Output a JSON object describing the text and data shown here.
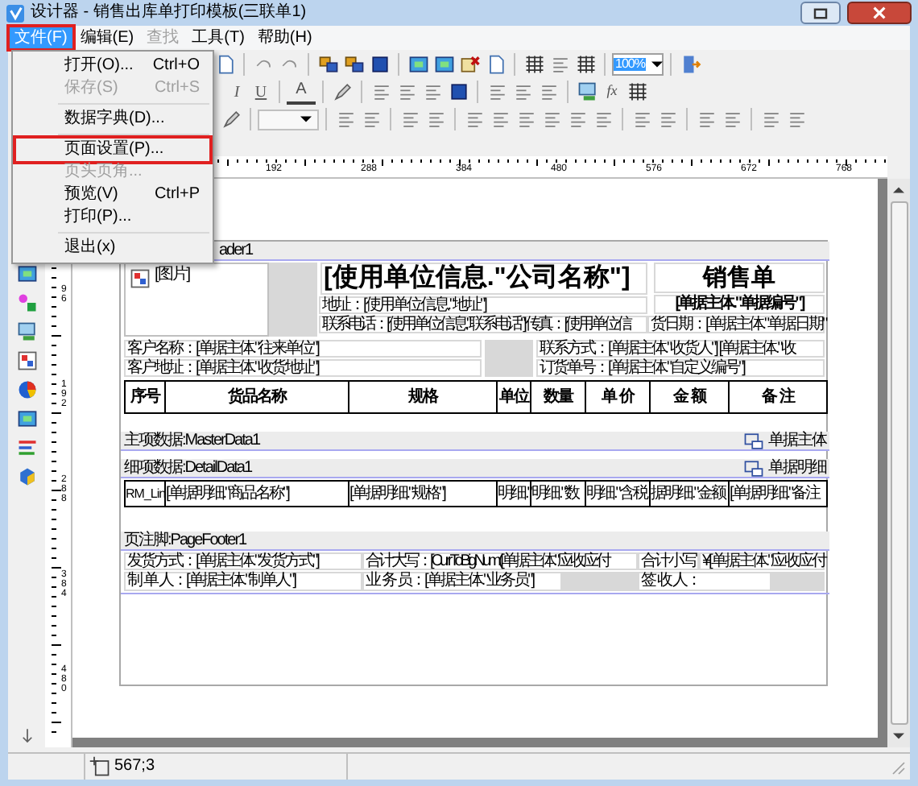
{
  "window": {
    "title": "设计器 - 销售出库单打印模板(三联单1)"
  },
  "menu_bar": [
    {
      "label": "文件(F)",
      "selected": true,
      "disabled": false
    },
    {
      "label": "编辑(E)",
      "selected": false,
      "disabled": false
    },
    {
      "label": "查找",
      "selected": false,
      "disabled": true
    },
    {
      "label": "工具(T)",
      "selected": false,
      "disabled": false
    },
    {
      "label": "帮助(H)",
      "selected": false,
      "disabled": false
    }
  ],
  "file_menu": [
    {
      "kind": "item",
      "label": "打开(O)...",
      "shortcut": "Ctrl+O",
      "disabled": false,
      "highlighted": false
    },
    {
      "kind": "item",
      "label": "保存(S)",
      "shortcut": "Ctrl+S",
      "disabled": true,
      "highlighted": false
    },
    {
      "kind": "separator"
    },
    {
      "kind": "item",
      "label": "数据字典(D)...",
      "disabled": false,
      "highlighted": false
    },
    {
      "kind": "separator"
    },
    {
      "kind": "item",
      "label": "页面设置(P)...",
      "disabled": false,
      "highlighted": true
    },
    {
      "kind": "item",
      "label": "页头页角...",
      "disabled": true,
      "highlighted": false
    },
    {
      "kind": "item",
      "label": "预览(V)",
      "shortcut": "Ctrl+P",
      "disabled": false,
      "highlighted": false
    },
    {
      "kind": "item",
      "label": "打印(P)...",
      "disabled": false,
      "highlighted": false
    },
    {
      "kind": "separator"
    },
    {
      "kind": "item",
      "label": "退出(x)",
      "disabled": false,
      "highlighted": false
    }
  ],
  "toolbar": {
    "zoom": "100%",
    "italic": "I",
    "underline": "U",
    "font_color": "A",
    "formula": "fx"
  },
  "rulers": {
    "horizontal": [
      "192",
      "288",
      "384",
      "480",
      "576",
      "672",
      "768"
    ],
    "vertical": [
      "96",
      "192",
      "288",
      "384",
      "480"
    ]
  },
  "report": {
    "page_header": {
      "band_label": "ader1",
      "picture_label": "[图片]",
      "company": "[使用单位信息.\"公司名称\"]",
      "address": "地址：[使用单位信息.\"地址\"]",
      "phone_fax": "联系电话：[使用单位信息.\"联系电话\"] 传真：[使用单位信",
      "doc_title": "销售单",
      "doc_number": "[单据主体.\"单据编号\"]",
      "doc_date": "货日期：[单据主体.\"单据日期\"",
      "customer_name": "客户名称：[单据主体.\"往来单位\"]",
      "customer_address": "客户地址：[单据主体.\"收货地址\"]",
      "contact": "联系方式：[单据主体.\"收货人\"] [单据主体.\"收",
      "order_number": "订货单号：[单据主体.\"自定义编号\"]"
    },
    "table_header": [
      "序号",
      "货品名称",
      "规格",
      "单位",
      "数量",
      "单 价",
      "金 额",
      "备 注"
    ],
    "master_band": {
      "label": "主项数据:MasterData1",
      "source": "单据主体"
    },
    "detail_band": {
      "label": "细项数据:DetailData1",
      "source": "单据明细"
    },
    "detail_cells": [
      "RM_Lin",
      "[单据明细.\"商品名称\"]",
      "[单据明细.\"规格\"]",
      "明细.\"",
      "明细.\"数",
      "明细.\"含税",
      "据明细.\"金额",
      "[单据明细.\"备注"
    ],
    "footer": {
      "band_label": "页注脚:PageFooter1",
      "shipping": "发货方式：[单据主体.\"发货方式\"]",
      "total_upper": "合计大写：[CurrToBigNum([单据主体.\"应收应付",
      "total_lower_label": "合计小写：",
      "total_lower": "¥[单据主体.\"应收应付",
      "maker": "制 单 人：[单据主体.\"制单人\"]",
      "salesman": "业 务 员：[单据主体.\"业务员\"]",
      "receiver": "签 收 人："
    }
  },
  "status_bar": {
    "position": "567;3"
  }
}
